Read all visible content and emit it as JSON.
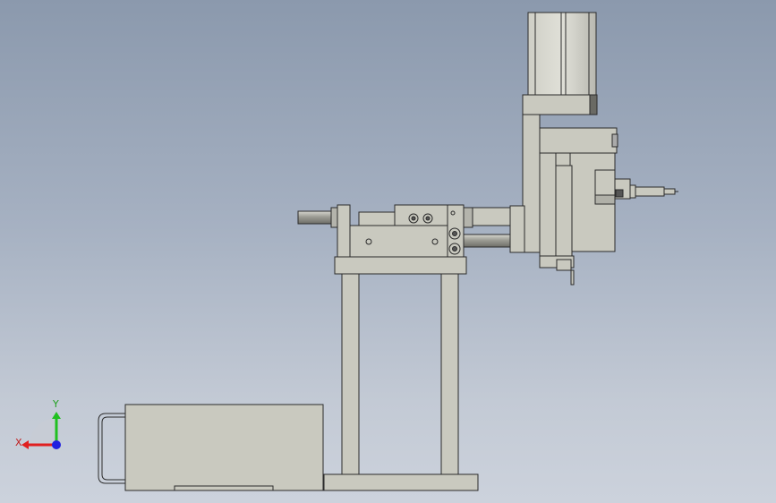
{
  "triad": {
    "x_label": "X",
    "y_label": "Y",
    "x_color": "#e02020",
    "y_color": "#20c020",
    "z_color": "#2020e0"
  },
  "model": {
    "fill": "#c9c9bf",
    "stroke": "#2b2b2b",
    "rod_fill": "#9a9a92"
  }
}
